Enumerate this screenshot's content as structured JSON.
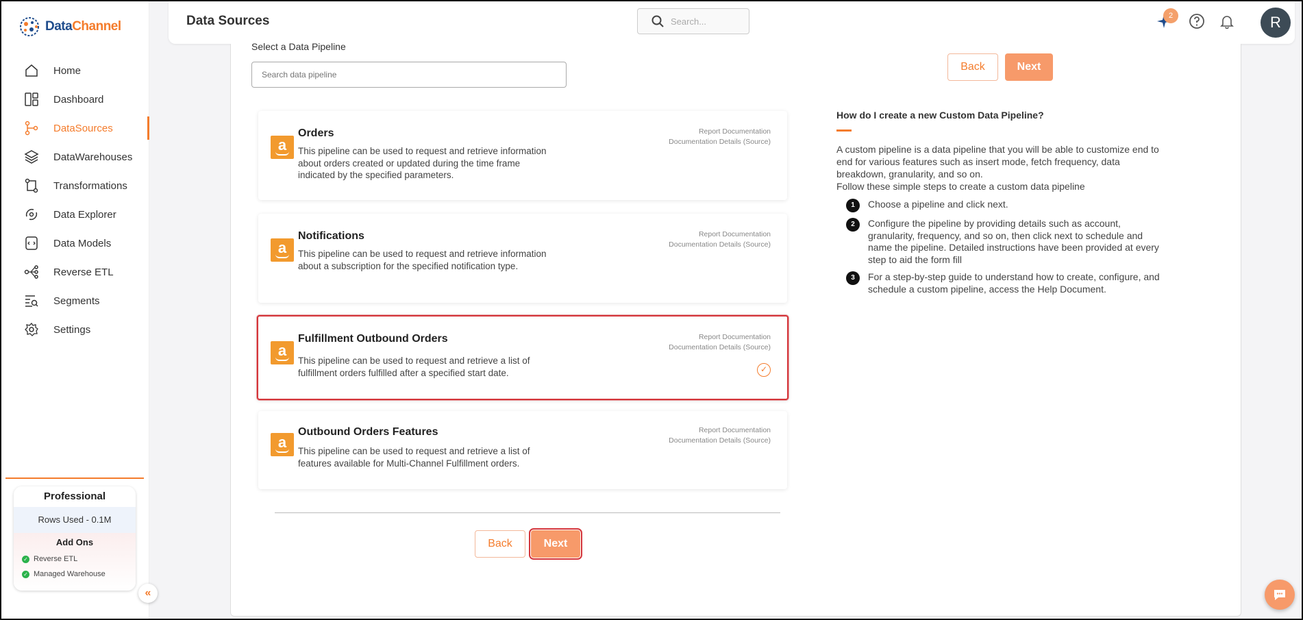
{
  "brand": {
    "name_part1": "Data",
    "name_part2": "Channel"
  },
  "sidebar": {
    "items": [
      {
        "label": "Home",
        "icon": "home-icon"
      },
      {
        "label": "Dashboard",
        "icon": "dashboard-icon"
      },
      {
        "label": "DataSources",
        "icon": "datasources-icon",
        "active": true
      },
      {
        "label": "DataWarehouses",
        "icon": "layers-icon"
      },
      {
        "label": "Transformations",
        "icon": "transform-icon"
      },
      {
        "label": "Data Explorer",
        "icon": "explorer-icon"
      },
      {
        "label": "Data Models",
        "icon": "models-icon"
      },
      {
        "label": "Reverse ETL",
        "icon": "reverse-etl-icon"
      },
      {
        "label": "Segments",
        "icon": "segments-icon"
      },
      {
        "label": "Settings",
        "icon": "gear-icon"
      }
    ],
    "plan": {
      "title": "Professional",
      "rows_used": "Rows Used - 0.1M",
      "addons_title": "Add Ons",
      "addons": [
        "Reverse ETL",
        "Managed Warehouse"
      ]
    }
  },
  "header": {
    "title": "Data Sources",
    "search_placeholder": "Search...",
    "sparkle_badge": "2",
    "avatar_initial": "R"
  },
  "main": {
    "select_label": "Select a Data Pipeline",
    "search_placeholder": "Search data pipeline",
    "back_label": "Back",
    "next_label": "Next",
    "pipelines": [
      {
        "name": "Orders",
        "description": "This pipeline can be used to request and retrieve information about orders created or updated during the time frame indicated by the specified parameters.",
        "link1": "Report Documentation",
        "link2": "Documentation Details (Source)",
        "selected": false
      },
      {
        "name": "Notifications",
        "description": "This pipeline can be used to request and retrieve information about a subscription for the specified notification type.",
        "link1": "Report Documentation",
        "link2": "Documentation Details (Source)",
        "selected": false
      },
      {
        "name": "Fulfillment Outbound Orders",
        "description": "This pipeline can be used to request and retrieve a list of fulfillment orders fulfilled after a specified start date.",
        "link1": "Report Documentation",
        "link2": "Documentation Details (Source)",
        "selected": true
      },
      {
        "name": "Outbound Orders Features",
        "description": "This pipeline can be used to request and retrieve a list of features available for Multi-Channel Fulfillment orders.",
        "link1": "Report Documentation",
        "link2": "Documentation Details (Source)",
        "selected": false
      }
    ],
    "help": {
      "title": "How do I create a new Custom Data Pipeline?",
      "intro": "A custom pipeline is a data pipeline that you will be able to customize end to end for various features such as insert mode, fetch frequency, data breakdown, granularity, and so on.",
      "intro2": "Follow these simple steps to create a custom data pipeline",
      "steps": [
        {
          "num": "1",
          "text": "Choose a pipeline and click next."
        },
        {
          "num": "2",
          "text": "Configure the pipeline by providing details such as account, granularity, frequency, and so on, then click next to schedule and name the pipeline. Detailed instructions have been provided at every step to aid the form fill"
        },
        {
          "num": "3",
          "text": "For a step-by-step guide to understand how to create, configure, and schedule a custom pipeline, access the Help Document."
        }
      ]
    }
  },
  "colors": {
    "accent": "#f47c2c",
    "next_button": "#f79a6a",
    "selected_border": "#d4353a"
  }
}
